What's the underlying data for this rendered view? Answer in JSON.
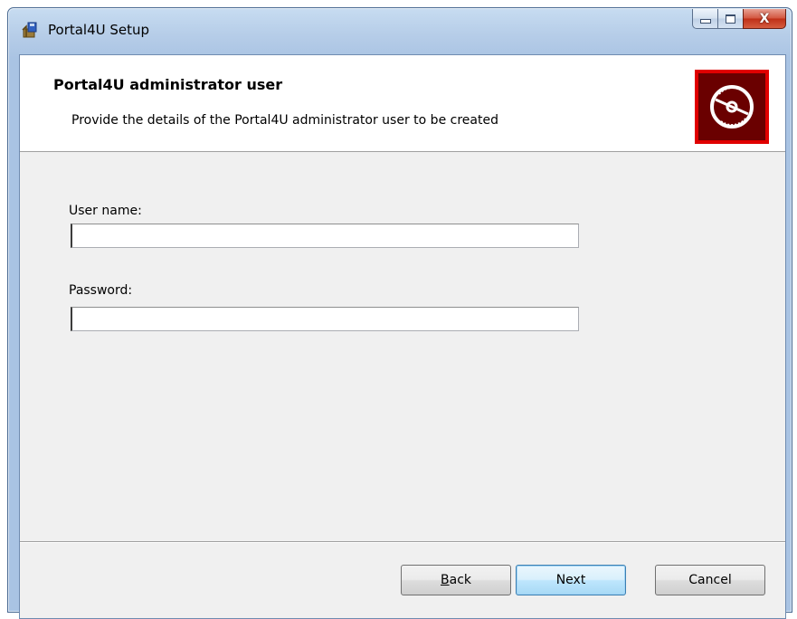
{
  "window": {
    "title": "Portal4U Setup",
    "close_symbol": "X",
    "icon": "setup-package-icon"
  },
  "banner": {
    "title": "Portal4U administrator user",
    "subtitle": "Provide the details of the Portal4U administrator user to be created",
    "logo_icon": "disc-icon",
    "logo_color": "#e00000"
  },
  "form": {
    "username_label": "User name:",
    "username_value": "",
    "password_label": "Password:",
    "password_value": ""
  },
  "buttons": {
    "back_label": "Back",
    "back_mnemonic": "B",
    "back_rest": "ack",
    "next_label": "Next",
    "cancel_label": "Cancel"
  }
}
